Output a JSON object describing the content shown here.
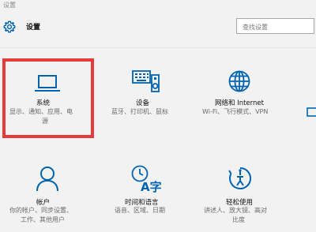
{
  "window": {
    "title": "设置"
  },
  "header": {
    "title": "设置",
    "gear_icon": "gear-icon",
    "search": {
      "placeholder": "查找设置"
    }
  },
  "accent_color": "#0063b1",
  "highlight_color": "#e63b3b",
  "tiles": [
    {
      "id": "system",
      "name": "系统",
      "desc_line1": "显示、通知、应用、电",
      "desc_line2": "源",
      "icon": "laptop-icon"
    },
    {
      "id": "devices",
      "name": "设备",
      "desc": "蓝牙、打印机、鼠标",
      "icon": "devices-icon"
    },
    {
      "id": "network",
      "name": "网络和 Internet",
      "desc": "Wi-Fi、飞行模式、VPN",
      "icon": "globe-icon"
    },
    {
      "id": "accounts",
      "name": "帐户",
      "desc_line1": "你的帐户、同步设置、",
      "desc_line2": "工作、其他用户",
      "icon": "person-icon"
    },
    {
      "id": "time-language",
      "name": "时间和语言",
      "desc": "语音、区域、日期",
      "icon": "time-language-icon"
    },
    {
      "id": "ease-of-access",
      "name": "轻松使用",
      "desc_line1": "讲述人、放大镜、高对",
      "desc_line2": "比度",
      "icon": "ease-of-access-icon"
    }
  ]
}
